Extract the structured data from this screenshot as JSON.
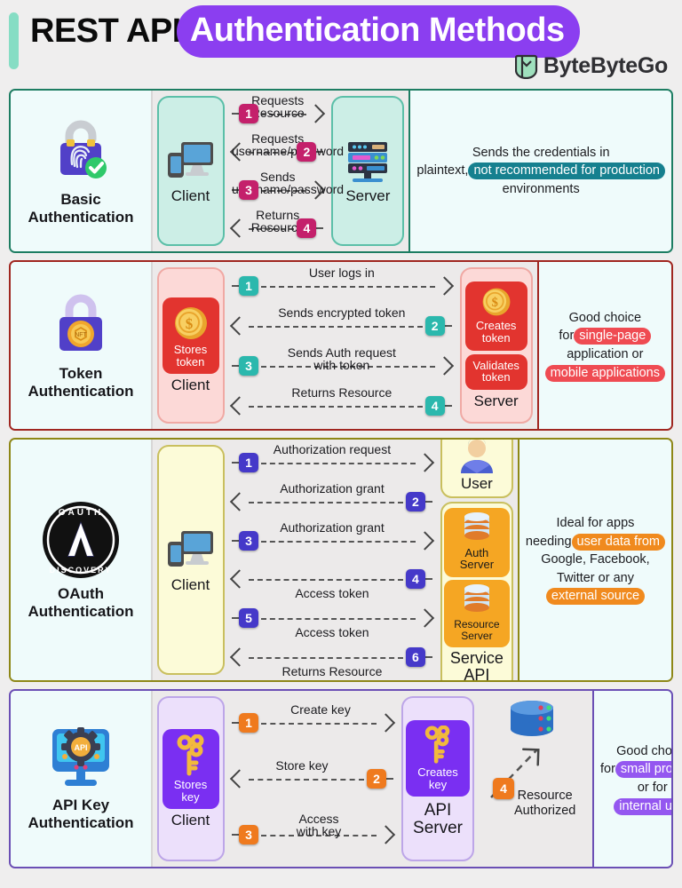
{
  "header": {
    "title_plain": "REST API",
    "title_highlight": "Authentication Methods",
    "brand": "ByteByteGo",
    "accent_bar": "#86ddc4",
    "highlight_bg": "#8b3ef0"
  },
  "rows": [
    {
      "id": "basic",
      "method_label": "Basic\nAuthentication",
      "border": "#1d7d62",
      "accent": "#c4206b",
      "node_fill": "#cceee6",
      "node_border": "#5bbfa8",
      "client_label": "Client",
      "client_icon": "devices-icon",
      "method_icon": "padlock-fingerprint-icon",
      "server_label": "Server",
      "server_icon": "server-rack-icon",
      "steps": [
        {
          "num": "1",
          "label": "Requests Resource",
          "dir": "right",
          "label_pos": "above"
        },
        {
          "num": "2",
          "label": "Requests\nusername/password",
          "dir": "left",
          "label_pos": "above"
        },
        {
          "num": "3",
          "label": "Sends\nusername/password",
          "dir": "right",
          "label_pos": "above"
        },
        {
          "num": "4",
          "label": "Returns Resource",
          "dir": "left",
          "label_pos": "mid"
        }
      ],
      "note_parts": [
        {
          "t": "Sends the credentials in plaintext,",
          "hl": false
        },
        {
          "t": "not recommended for production",
          "hl": true
        },
        {
          "t": " environments",
          "hl": false
        }
      ],
      "note_hl_color": "#16808f"
    },
    {
      "id": "token",
      "method_label": "Token\nAuthentication",
      "border": "#a02620",
      "accent": "#2bb8ad",
      "node_fill": "#fcd9d7",
      "node_border": "#f0a9a4",
      "client_label": "Client",
      "client_icon": "token-coin-icon",
      "method_icon": "padlock-nft-coin-icon",
      "server_label": "Server",
      "server_icon": "token-coin-icon",
      "client_chip": "Stores\ntoken",
      "server_chips": [
        "Creates\ntoken",
        "Validates\ntoken"
      ],
      "chip_color": "#e2342f",
      "steps": [
        {
          "num": "1",
          "label": "User logs in",
          "dir": "right",
          "label_pos": "above"
        },
        {
          "num": "2",
          "label": "Sends encrypted token",
          "dir": "left",
          "label_pos": "mid"
        },
        {
          "num": "3",
          "label": "Sends Auth request\nwith token",
          "dir": "right",
          "label_pos": "above"
        },
        {
          "num": "4",
          "label": "Returns Resource",
          "dir": "left",
          "label_pos": "mid"
        }
      ],
      "note_parts": [
        {
          "t": "Good choice for",
          "hl": false
        },
        {
          "t": "single-page",
          "hl": true
        },
        {
          "t": " application or ",
          "hl": false
        },
        {
          "t": "mobile applications",
          "hl": true
        }
      ],
      "note_hl_color": "#ef4b52"
    },
    {
      "id": "oauth",
      "method_label": "OAuth\nAuthentication",
      "border": "#8e8717",
      "accent": "#4539c9",
      "node_fill": "#fcfbd8",
      "node_border": "#c9bf5e",
      "client_label": "Client",
      "client_icon": "devices-icon",
      "method_icon": "oauth-discovery-badge-icon",
      "server_label": "Service\nAPI",
      "user_label": "User",
      "user_icon": "user-avatar-icon",
      "server_chips": [
        "Auth\nServer",
        "Resource\nServer"
      ],
      "chip_color": "#f5a623",
      "steps": [
        {
          "num": "1",
          "label": "Authorization request",
          "dir": "right",
          "label_pos": "above"
        },
        {
          "num": "2",
          "label": "Authorization grant",
          "dir": "left",
          "label_pos": "above"
        },
        {
          "num": "3",
          "label": "Authorization grant",
          "dir": "right",
          "label_pos": "above"
        },
        {
          "num": "4",
          "label": "Access token",
          "dir": "left",
          "label_pos": "below"
        },
        {
          "num": "5",
          "label": "Access token",
          "dir": "right",
          "label_pos": "below"
        },
        {
          "num": "6",
          "label": "Returns Resource",
          "dir": "left",
          "label_pos": "below"
        }
      ],
      "note_parts": [
        {
          "t": "Ideal for apps needing",
          "hl": false
        },
        {
          "t": "user data from",
          "hl": true
        },
        {
          "t": " Google, Facebook, Twitter or any ",
          "hl": false
        },
        {
          "t": "external source",
          "hl": true
        }
      ],
      "note_hl_color": "#f08a1e"
    },
    {
      "id": "apikey",
      "method_label": "API Key\nAuthentication",
      "border": "#6b4fb5",
      "accent": "#ef7a1e",
      "node_fill": "#ece0fb",
      "node_border": "#bda6e8",
      "client_label": "Client",
      "client_icon": "key-icon",
      "method_icon": "api-gear-monitor-icon",
      "server_label": "API\nServer",
      "server_icon": "key-icon",
      "client_chip": "Stores\nkey",
      "server_chip": "Creates\nkey",
      "chip_color": "#7a2ff2",
      "db_label": "Resource\nAuthorized",
      "db_step": "4",
      "db_icon": "database-icon",
      "steps": [
        {
          "num": "1",
          "label": "Create key",
          "dir": "right",
          "label_pos": "above"
        },
        {
          "num": "2",
          "label": "Store key",
          "dir": "left",
          "label_pos": "above"
        },
        {
          "num": "3",
          "label": "Access\nwith key",
          "dir": "right",
          "label_pos": "above"
        }
      ],
      "note_parts": [
        {
          "t": "Good choice for",
          "hl": false
        },
        {
          "t": "small projects",
          "hl": true
        },
        {
          "t": " or for ",
          "hl": false
        },
        {
          "t": "internal use",
          "hl": true
        }
      ],
      "note_hl_color": "#9457f0"
    }
  ]
}
